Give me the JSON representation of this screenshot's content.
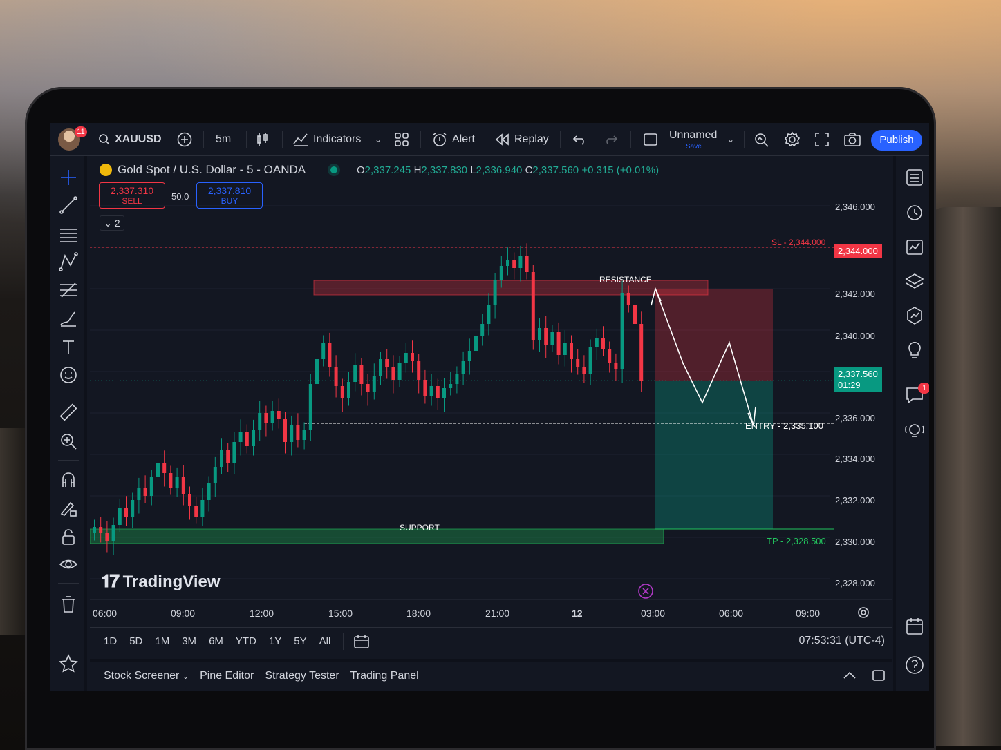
{
  "topbar": {
    "notification_count": "11",
    "symbol": "XAUUSD",
    "timeframe": "5m",
    "indicators_label": "Indicators",
    "alert_label": "Alert",
    "replay_label": "Replay",
    "layout_name": "Unnamed",
    "layout_save": "Save",
    "publish_label": "Publish"
  },
  "legend": {
    "title": "Gold Spot / U.S. Dollar - 5 - OANDA",
    "o_label": "O",
    "o_value": "2,337.245",
    "h_label": "H",
    "h_value": "2,337.830",
    "l_label": "L",
    "l_value": "2,336.940",
    "c_label": "C",
    "c_value": "2,337.560",
    "change": "+0.315 (+0.01%)",
    "sell_price": "2,337.310",
    "sell_label": "SELL",
    "spread": "50.0",
    "buy_price": "2,337.810",
    "buy_label": "BUY",
    "indicators_collapsed": "2"
  },
  "price_axis": [
    "2,346.000",
    "2,342.000",
    "2,340.000",
    "2,336.000",
    "2,334.000",
    "2,332.000",
    "2,330.000",
    "2,328.000"
  ],
  "price_tags": {
    "sl_tag": "2,344.000",
    "current_price": "2,337.560",
    "countdown": "01:29"
  },
  "time_axis": [
    "06:00",
    "09:00",
    "12:00",
    "15:00",
    "18:00",
    "21:00",
    "12",
    "03:00",
    "06:00",
    "09:00"
  ],
  "annotations": {
    "sl": "SL - 2,344.000",
    "resistance": "RESISTANCE",
    "entry": "ENTRY - 2,335.100",
    "support": "SUPPORT",
    "tp": "TP - 2,328.500"
  },
  "watermark": "TradingView",
  "range_buttons": [
    "1D",
    "5D",
    "1M",
    "3M",
    "6M",
    "YTD",
    "1Y",
    "5Y",
    "All"
  ],
  "clock": "07:53:31 (UTC-4)",
  "bottom_panel": [
    "Stock Screener",
    "Pine Editor",
    "Strategy Tester",
    "Trading Panel"
  ],
  "right_badge": "1",
  "colors": {
    "up": "#089981",
    "down": "#f23645",
    "accent": "#2962ff",
    "bg": "#131722"
  },
  "chart_data": {
    "type": "candlestick",
    "ylim": [
      2327,
      2347
    ],
    "candles_close": [
      2330.5,
      2330.2,
      2329.8,
      2330.6,
      2331.4,
      2331.0,
      2331.8,
      2332.4,
      2332.0,
      2332.9,
      2333.6,
      2333.1,
      2332.4,
      2332.9,
      2332.1,
      2331.5,
      2331.0,
      2331.8,
      2332.6,
      2333.4,
      2334.2,
      2333.6,
      2334.6,
      2335.1,
      2334.4,
      2335.2,
      2336.0,
      2335.5,
      2336.1,
      2335.7,
      2334.6,
      2335.4,
      2334.7,
      2335.2,
      2337.4,
      2338.6,
      2339.4,
      2338.2,
      2337.3,
      2336.7,
      2337.5,
      2338.3,
      2337.4,
      2337.0,
      2337.8,
      2338.6,
      2338.2,
      2337.6,
      2338.4,
      2338.9,
      2338.5,
      2337.6,
      2336.8,
      2337.3,
      2336.7,
      2337.2,
      2337.4,
      2337.9,
      2338.5,
      2339.0,
      2339.7,
      2340.3,
      2341.2,
      2342.4,
      2343.1,
      2343.4,
      2343.0,
      2343.6,
      2342.8,
      2339.5,
      2340.1,
      2339.3,
      2339.9,
      2338.8,
      2339.4,
      2338.6,
      2338.2,
      2337.9,
      2339.2,
      2339.6,
      2339.1,
      2338.4,
      2338.1,
      2341.8,
      2341.2,
      2340.3,
      2337.56
    ]
  }
}
